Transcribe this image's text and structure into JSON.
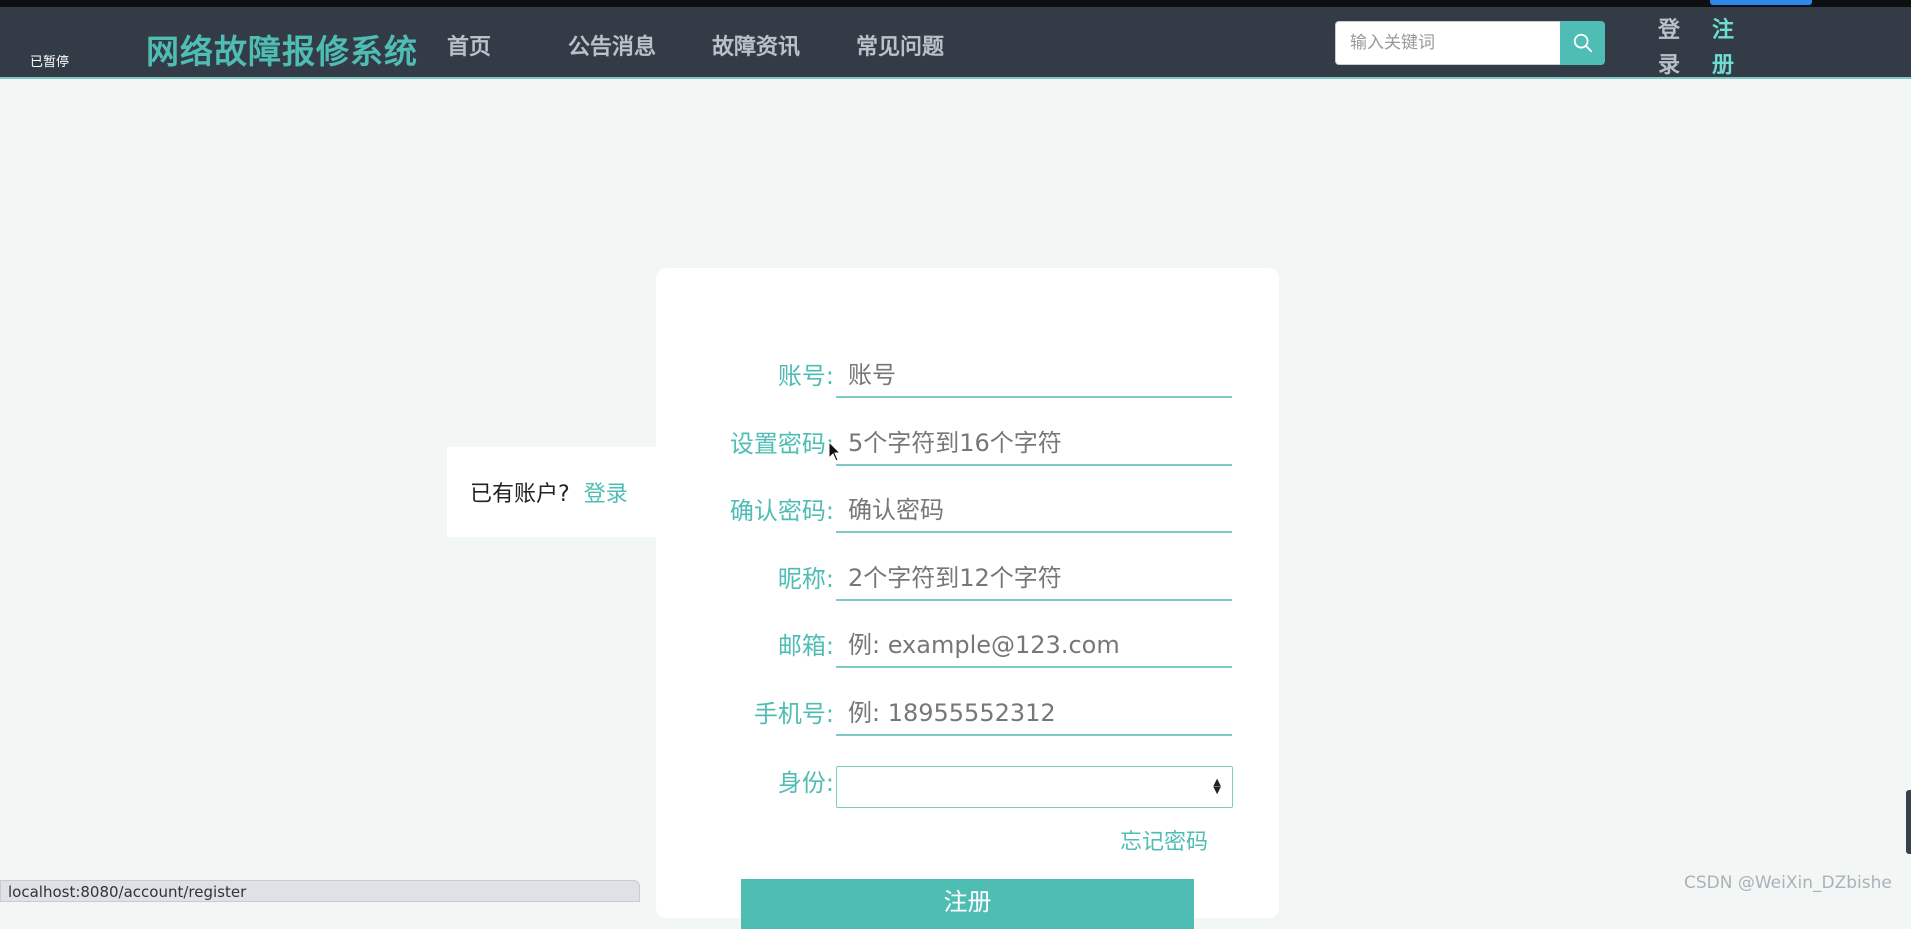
{
  "status": {
    "paused_label": "已暂停",
    "url": "localhost:8080/account/register"
  },
  "header": {
    "brand": "网络故障报修系统",
    "nav": [
      "首页",
      "公告消息",
      "故障资讯",
      "常见问题"
    ],
    "search_placeholder": "输入关键词",
    "login_label": "登录",
    "register_label": "注册",
    "colors": {
      "brand": "#4fbdb4",
      "register": "#6fdcd3",
      "nav_bg": "#323b46"
    }
  },
  "side": {
    "has_account": "已有账户?",
    "login_link": "登录"
  },
  "form": {
    "fields": [
      {
        "label": "账号:",
        "placeholder": "账号"
      },
      {
        "label": "设置密码:",
        "placeholder": "5个字符到16个字符"
      },
      {
        "label": "确认密码:",
        "placeholder": "确认密码"
      },
      {
        "label": "昵称:",
        "placeholder": "2个字符到12个字符"
      },
      {
        "label": "邮箱:",
        "placeholder": "例: example@123.com"
      },
      {
        "label": "手机号:",
        "placeholder": "例: 18955552312"
      }
    ],
    "role_label": "身份:",
    "role_value": "",
    "forgot": "忘记密码",
    "submit": "注册"
  },
  "watermark": "CSDN @WeiXin_DZbishe"
}
